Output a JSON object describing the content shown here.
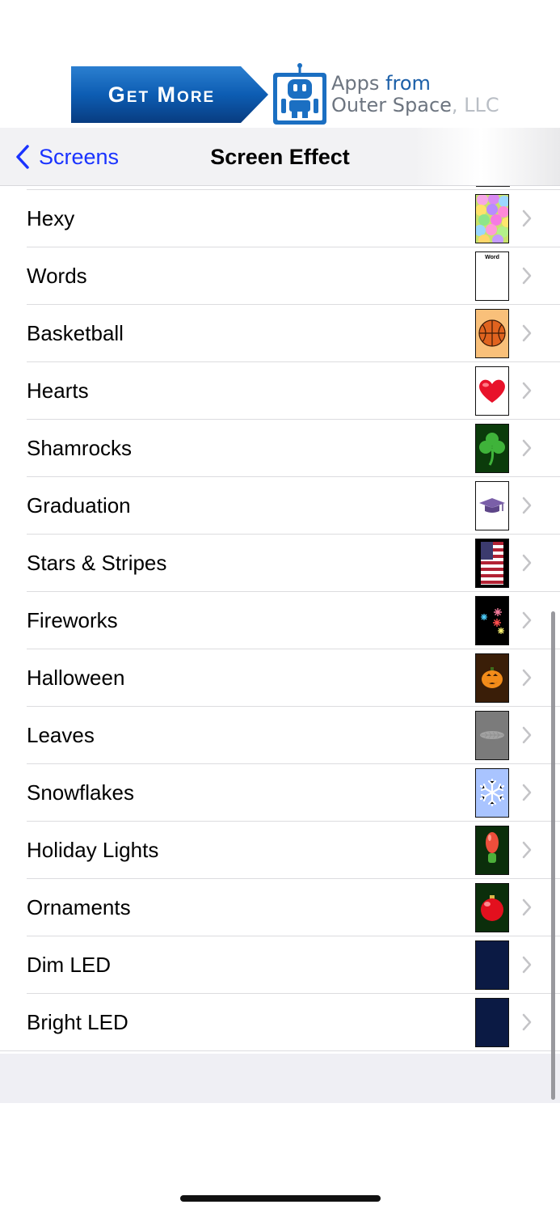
{
  "ad": {
    "cta": "Get More",
    "brand_line1_a": "Apps ",
    "brand_line1_b": "from",
    "brand_line2_a": "Outer Space",
    "brand_line2_b": ", LLC"
  },
  "nav": {
    "back_label": "Screens",
    "title": "Screen Effect"
  },
  "thumb_word": "Word",
  "items": [
    {
      "label": "Hexy",
      "icon": "hexy-thumbnail"
    },
    {
      "label": "Words",
      "icon": "words-thumbnail"
    },
    {
      "label": "Basketball",
      "icon": "basketball-thumbnail"
    },
    {
      "label": "Hearts",
      "icon": "heart-thumbnail"
    },
    {
      "label": "Shamrocks",
      "icon": "shamrock-thumbnail"
    },
    {
      "label": "Graduation",
      "icon": "graduation-cap-thumbnail"
    },
    {
      "label": "Stars & Stripes",
      "icon": "flag-thumbnail"
    },
    {
      "label": "Fireworks",
      "icon": "fireworks-thumbnail"
    },
    {
      "label": "Halloween",
      "icon": "pumpkin-thumbnail"
    },
    {
      "label": "Leaves",
      "icon": "leaf-thumbnail"
    },
    {
      "label": "Snowflakes",
      "icon": "snowflake-thumbnail"
    },
    {
      "label": "Holiday Lights",
      "icon": "holiday-light-thumbnail"
    },
    {
      "label": "Ornaments",
      "icon": "ornament-thumbnail"
    },
    {
      "label": "Dim LED",
      "icon": "dim-led-thumbnail"
    },
    {
      "label": "Bright LED",
      "icon": "bright-led-thumbnail"
    }
  ],
  "colors": {
    "accent": "#1a33ff",
    "led": "#0b1a44"
  }
}
